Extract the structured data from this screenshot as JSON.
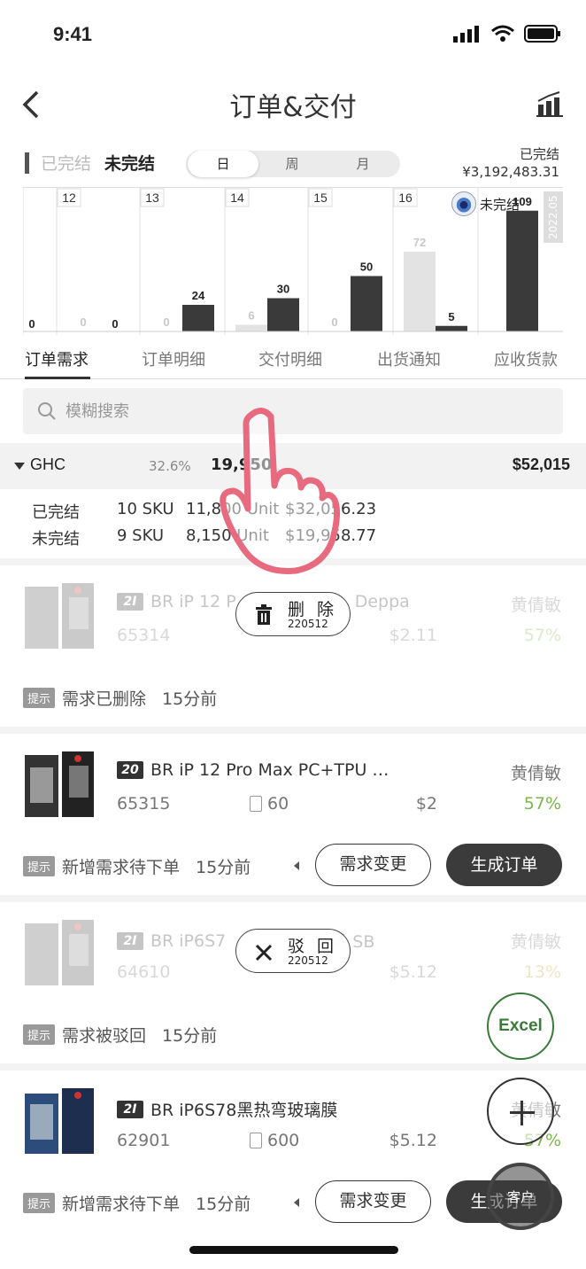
{
  "status": {
    "time": "9:41"
  },
  "nav": {
    "title": "订单&交付"
  },
  "toggle": {
    "done_label": "已完结",
    "open_label": "未完结",
    "periods": [
      "日",
      "周",
      "月"
    ],
    "active_period": "日",
    "done_total_label": "已完结",
    "done_total_value": "¥3,192,483.31"
  },
  "chart_data": {
    "type": "bar",
    "categories": [
      "",
      "12",
      "13",
      "14",
      "15",
      "16",
      ""
    ],
    "series": [
      {
        "name": "已完结",
        "values": [
          null,
          0,
          0,
          6,
          0,
          72,
          null
        ]
      },
      {
        "name": "未完结",
        "values": [
          0,
          0,
          24,
          30,
          50,
          5,
          109
        ]
      }
    ],
    "legend_label": "未完结",
    "year_tag": "2022.05",
    "colors": {
      "done": "#e3e3e3",
      "open": "#3a3a3a"
    }
  },
  "tabs": [
    "订单需求",
    "订单明细",
    "交付明细",
    "出货通知",
    "应收货款"
  ],
  "search": {
    "placeholder": "模糊搜索"
  },
  "group": {
    "name": "GHC",
    "pct": "32.6%",
    "value": "19,950",
    "total": "$52,015"
  },
  "summary": [
    {
      "label": "已完结",
      "sku": "10 SKU",
      "units": "11,800 Unit",
      "amount": "$32,056.23"
    },
    {
      "label": "未完结",
      "sku": "9 SKU",
      "units": "8,150 Unit",
      "amount": "$19,958.77"
    }
  ],
  "cards": [
    {
      "badge": "2I",
      "name": "BR iP 12 P",
      "name_tail": "Deppa",
      "code": "65314",
      "qty": "",
      "price": "$2.11",
      "owner": "黄倩敏",
      "pct": "57%",
      "tip_badge": "提示",
      "tip": "需求已删除",
      "time": "15分前",
      "overlay": {
        "label": "删 除",
        "code": "220512"
      }
    },
    {
      "badge": "20",
      "name": "BR iP 12 Pro Max PC+TPU …",
      "code": "65315",
      "qty": "60",
      "price": "$2",
      "owner": "黄倩敏",
      "pct": "57%",
      "tip_badge": "提示",
      "tip": "新增需求待下单",
      "time": "15分前",
      "btn_change": "需求变更",
      "btn_order": "生成订单"
    },
    {
      "badge": "2I",
      "name": "BR iP6S7",
      "name_tail": "黑 SB",
      "code": "64610",
      "qty": "",
      "price": "$5.12",
      "owner": "黄倩敏",
      "pct": "13%",
      "tip_badge": "提示",
      "tip": "需求被驳回",
      "time": "15分前",
      "overlay": {
        "label": "驳 回",
        "code": "220512"
      }
    },
    {
      "badge": "2I",
      "name": "BR iP6S78黑热弯玻璃膜",
      "code": "62901",
      "qty": "600",
      "price": "$5.12",
      "owner": "黄倩敏",
      "pct": "57%",
      "tip_badge": "提示",
      "tip": "新增需求待下单",
      "time": "15分前",
      "btn_change": "需求变更",
      "btn_order": "生成订单"
    }
  ],
  "fabs": {
    "excel": "Excel",
    "customer": "客户"
  }
}
